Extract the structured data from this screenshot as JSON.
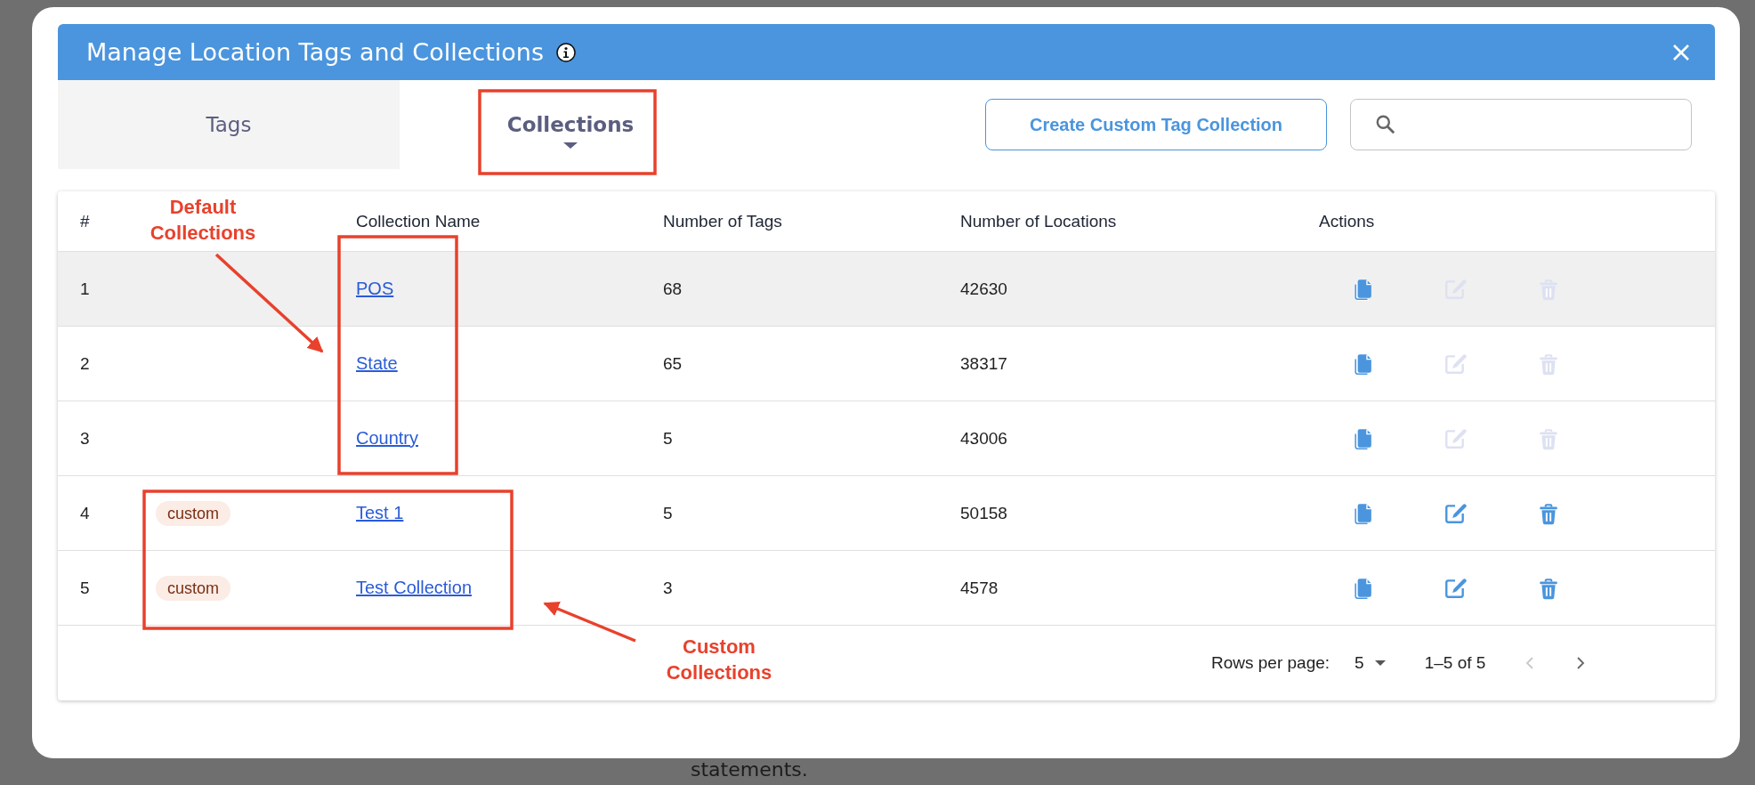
{
  "background": {
    "text": "statements."
  },
  "dialog": {
    "title": "Manage Location Tags and Collections",
    "info": true
  },
  "tabs": [
    {
      "label": "Tags",
      "selected": false
    },
    {
      "label": "Collections",
      "selected": true
    }
  ],
  "create_button": "Create Custom Tag Collection",
  "table": {
    "columns": [
      "#",
      "Collection Name",
      "Number of Tags",
      "Number of Locations",
      "Actions"
    ],
    "rows": [
      {
        "index": "1",
        "name": "POS",
        "tags": "68",
        "locations": "42630",
        "hovered": true,
        "editable": false
      },
      {
        "index": "2",
        "name": "State",
        "tags": "65",
        "locations": "38317",
        "hovered": false,
        "editable": false
      },
      {
        "index": "3",
        "name": "Country",
        "tags": "5",
        "locations": "43006",
        "hovered": false,
        "editable": false
      },
      {
        "index": "4",
        "tag": "custom",
        "name": "Test 1",
        "tags": "5",
        "locations": "50158",
        "hovered": false,
        "editable": true
      },
      {
        "index": "5",
        "tag": "custom",
        "name": "Test Collection",
        "tags": "3",
        "locations": "4578",
        "hovered": false,
        "editable": true
      }
    ]
  },
  "pagination": {
    "rows_per_page_label": "Rows per page:",
    "rows_per_page": "5",
    "range": "1–5 of 5",
    "prev_disabled": true,
    "next_disabled": false
  },
  "annotations": [
    {
      "text": "Default Collections"
    },
    {
      "text": "Custom Collections"
    }
  ]
}
